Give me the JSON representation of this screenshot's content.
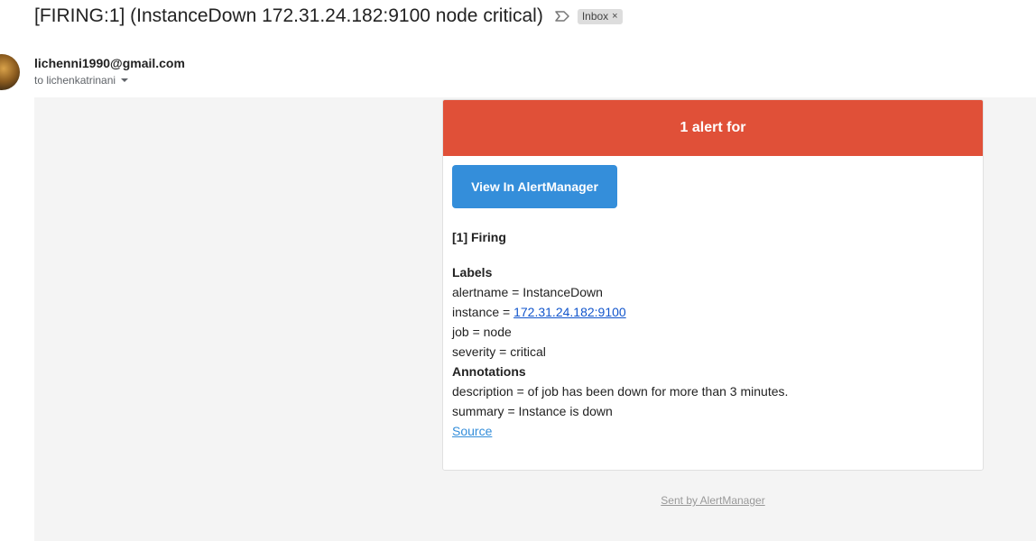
{
  "email": {
    "subject": "[FIRING:1] (InstanceDown 172.31.24.182:9100 node critical)",
    "importance_icon": "label-arrow-icon",
    "label_chip": "Inbox",
    "label_chip_close": "×",
    "sender": "lichenni1990@gmail.com",
    "recipient": "to lichenkatrinani"
  },
  "alert": {
    "header": "1 alert for",
    "header_color": "#e05038",
    "button_label": "View In AlertManager",
    "button_color": "#348eda",
    "firing_title": "[1] Firing",
    "labels_title": "Labels",
    "labels": {
      "alertname": "alertname = InstanceDown",
      "instance_prefix": "instance = ",
      "instance_link": "172.31.24.182:9100",
      "job": "job = node",
      "severity": "severity = critical"
    },
    "annotations_title": "Annotations",
    "annotations": {
      "description": "description = of job has been down for more than 3 minutes.",
      "summary": "summary = Instance is down"
    },
    "source_link": "Source"
  },
  "footer": {
    "sent_by": "Sent by AlertManager"
  }
}
